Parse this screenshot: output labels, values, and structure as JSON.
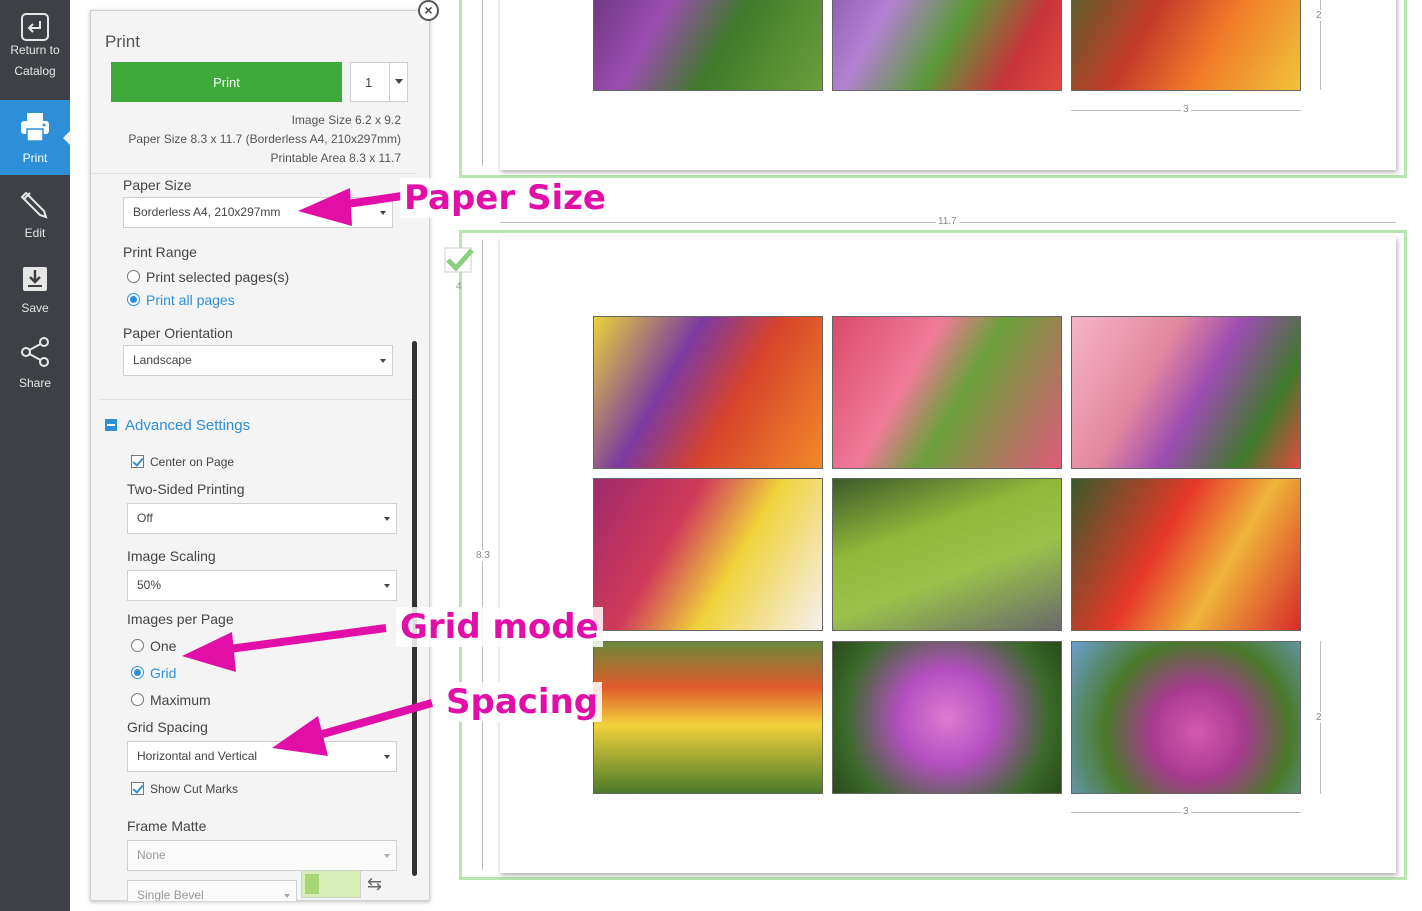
{
  "sidebar": {
    "items": [
      {
        "label": "Return to Catalog",
        "icon": "return-icon"
      },
      {
        "label": "Print",
        "icon": "printer-icon",
        "active": true
      },
      {
        "label": "Edit",
        "icon": "pencil-icon"
      },
      {
        "label": "Save",
        "icon": "download-icon"
      },
      {
        "label": "Share",
        "icon": "share-icon"
      }
    ]
  },
  "panel": {
    "title": "Print",
    "print_button": "Print",
    "copies": "1",
    "image_size": "Image Size 6.2 x 9.2",
    "paper_size_info": "Paper Size 8.3 x 11.7 (Borderless A4, 210x297mm)",
    "printable_area": "Printable Area 8.3 x 11.7",
    "paper_size": {
      "label": "Paper Size",
      "value": "Borderless A4, 210x297mm"
    },
    "print_range": {
      "label": "Print Range",
      "options": [
        "Print selected pages(s)",
        "Print all pages"
      ],
      "selected": "Print all pages"
    },
    "orientation": {
      "label": "Paper Orientation",
      "value": "Landscape"
    },
    "advanced": {
      "heading": "Advanced Settings",
      "center_on_page": "Center on Page",
      "two_sided": {
        "label": "Two-Sided Printing",
        "value": "Off"
      },
      "scaling": {
        "label": "Image Scaling",
        "value": "50%"
      },
      "images_per_page": {
        "label": "Images per Page",
        "options": [
          "One",
          "Grid",
          "Maximum"
        ],
        "selected": "Grid"
      },
      "grid_spacing": {
        "label": "Grid Spacing",
        "value": "Horizontal and Vertical"
      },
      "cut_marks": "Show Cut Marks",
      "frame_matte": {
        "label": "Frame Matte",
        "value": "None",
        "bevel": "Single Bevel"
      }
    }
  },
  "preview": {
    "page_width_label": "11.7",
    "page_height_label": "8.3",
    "photo_width_label": "3",
    "photo_height_label": "2",
    "page_number": "4",
    "colors": {
      "frame": "#b9e6b0",
      "accent": "#2d8fd8",
      "print_green": "#3daa3a",
      "annotation": "#e20ea8"
    }
  },
  "annotations": {
    "paper_size": "Paper Size",
    "grid_mode": "Grid mode",
    "spacing": "Spacing"
  }
}
